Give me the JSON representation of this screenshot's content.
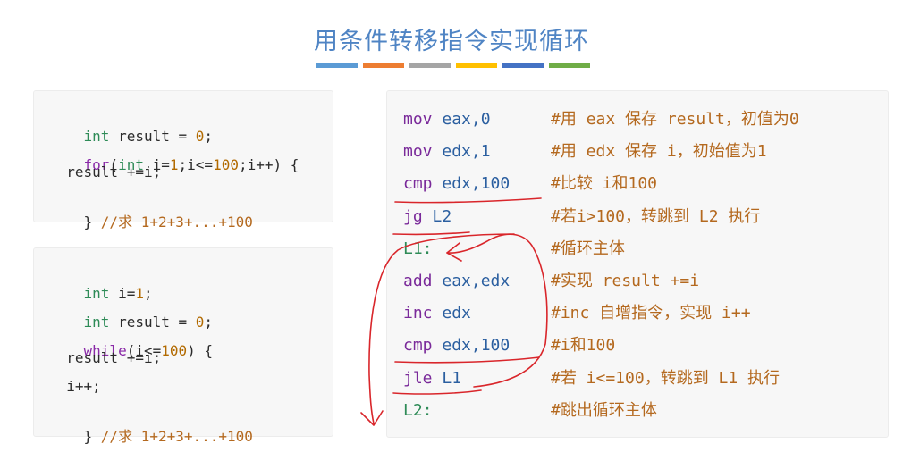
{
  "title": "用条件转移指令实现循环",
  "stripe_colors": [
    "#5b9bd5",
    "#ed7d31",
    "#a5a5a5",
    "#ffc000",
    "#4472c4",
    "#70ad47"
  ],
  "for_code": {
    "l1_type": "int",
    "l1_rest": " result = ",
    "l1_num": "0",
    "l1_end": ";",
    "l2_for": "for",
    "l2_a": "(",
    "l2_int": "int",
    "l2_b": " i=",
    "l2_one": "1",
    "l2_c": ";i<=",
    "l2_hundred": "100",
    "l2_d": ";i++) {",
    "l3": "  result +=i;",
    "l4_brace": "} ",
    "l4_comment": "//求 1+2+3+...+100"
  },
  "while_code": {
    "l1_type": "int",
    "l1_rest": " i=",
    "l1_num": "1",
    "l1_end": ";",
    "l2_type": "int",
    "l2_rest": " result = ",
    "l2_num": "0",
    "l2_end": ";",
    "l3_kw": "while",
    "l3_a": "(i<=",
    "l3_num": "100",
    "l3_b": ") {",
    "l4": "  result +=i;",
    "l5": "  i++;",
    "l6_brace": "} ",
    "l6_comment": "//求 1+2+3+...+100"
  },
  "asm": [
    {
      "op": "mov",
      "args": " eax,0",
      "comment": "#用 eax 保存 result，初值为0"
    },
    {
      "op": "mov",
      "args": " edx,1",
      "comment": "#用 edx 保存 i，初始值为1"
    },
    {
      "op": "cmp",
      "args": " edx,100",
      "comment": "#比较 i和100"
    },
    {
      "op": "jg",
      "args": " L2",
      "comment": "#若i>100，转跳到 L2 执行"
    },
    {
      "op": "L1:",
      "args": "",
      "comment": "#循环主体"
    },
    {
      "op": "add",
      "args": " eax,edx",
      "comment": "#实现 result +=i"
    },
    {
      "op": "inc",
      "args": " edx",
      "comment": "#inc 自增指令，实现 i++"
    },
    {
      "op": "cmp",
      "args": " edx,100",
      "comment": "#i和100"
    },
    {
      "op": "jle",
      "args": " L1",
      "comment": "#若 i<=100，转跳到 L1 执行"
    },
    {
      "op": "L2:",
      "args": "",
      "comment": "#跳出循环主体"
    }
  ]
}
